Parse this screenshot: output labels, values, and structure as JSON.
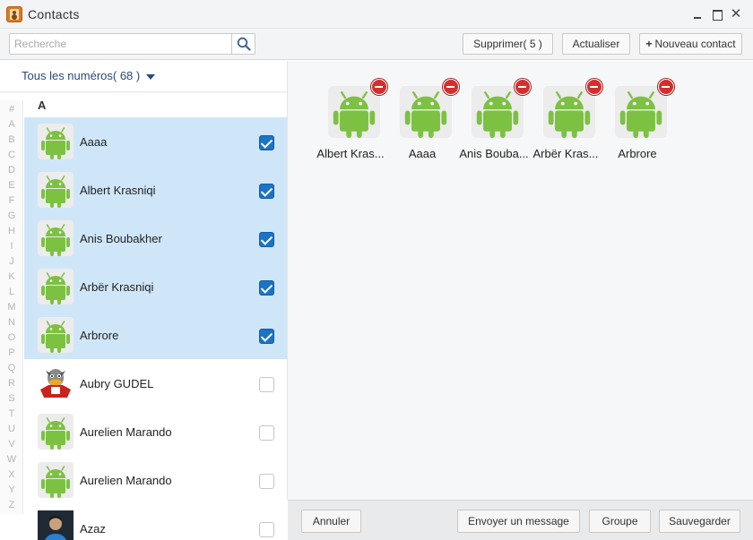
{
  "window": {
    "title": "Contacts",
    "app_icon": "contacts-book-icon"
  },
  "toolbar": {
    "search_placeholder": "Recherche",
    "search_icon": "magnifier-icon",
    "delete_label": "Supprimer( 5 )",
    "refresh_label": "Actualiser",
    "new_contact_plus": "+",
    "new_contact_label": "Nouveau contact"
  },
  "filter": {
    "label": "Tous les numéros( 68 )"
  },
  "alphabet": [
    "#",
    "A",
    "B",
    "C",
    "D",
    "E",
    "F",
    "G",
    "H",
    "I",
    "J",
    "K",
    "L",
    "M",
    "N",
    "O",
    "P",
    "Q",
    "R",
    "S",
    "T",
    "U",
    "V",
    "W",
    "X",
    "Y",
    "Z"
  ],
  "section": "A",
  "contacts": [
    {
      "name": "Aaaa",
      "avatar": "android-icon",
      "checked": true
    },
    {
      "name": "Albert Krasniqi",
      "avatar": "android-icon",
      "checked": true
    },
    {
      "name": "Anis Boubakher",
      "avatar": "android-icon",
      "checked": true
    },
    {
      "name": "Arbër Krasniqi",
      "avatar": "android-icon",
      "checked": true
    },
    {
      "name": "Arbrore",
      "avatar": "android-icon",
      "checked": true
    },
    {
      "name": "Aubry GUDEL",
      "avatar": "cartoon-photo",
      "checked": false
    },
    {
      "name": "Aurelien Marando",
      "avatar": "android-icon",
      "checked": false
    },
    {
      "name": "Aurelien Marando",
      "avatar": "android-icon",
      "checked": false
    },
    {
      "name": "Azaz",
      "avatar": "person-photo",
      "checked": false
    }
  ],
  "selected": [
    {
      "name": "Albert Kras...",
      "avatar": "android-icon"
    },
    {
      "name": "Aaaa",
      "avatar": "android-icon"
    },
    {
      "name": "Anis Bouba...",
      "avatar": "android-icon"
    },
    {
      "name": "Arbër Kras...",
      "avatar": "android-icon"
    },
    {
      "name": "Arbrore",
      "avatar": "android-icon"
    }
  ],
  "bottom": {
    "cancel_label": "Annuler",
    "message_label": "Envoyer un message",
    "group_label": "Groupe",
    "save_label": "Sauvegarder"
  },
  "colors": {
    "selected_row": "#cfe6f8",
    "checkbox_on": "#1b74c5",
    "android_green": "#7cc142",
    "remove_badge": "#d32f2f"
  }
}
